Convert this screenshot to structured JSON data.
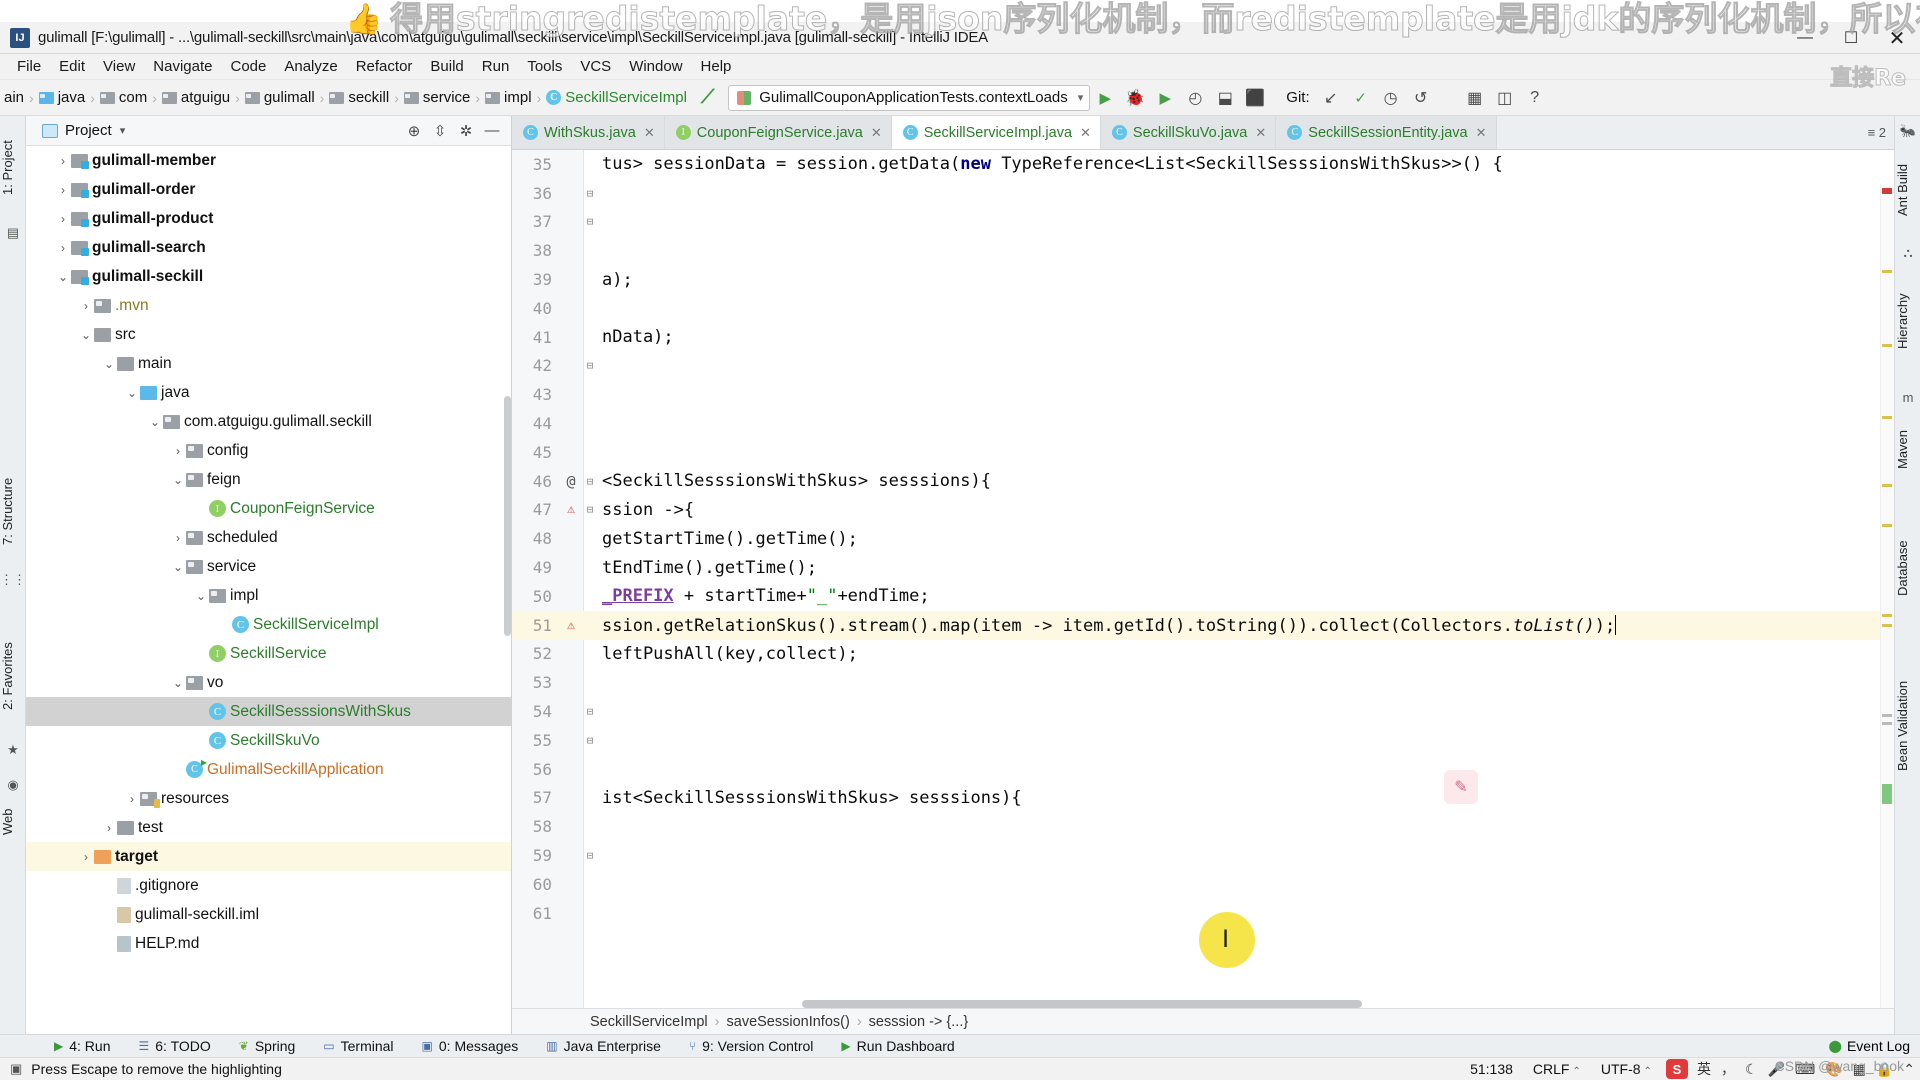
{
  "window": {
    "title": "gulimall [F:\\gulimall] - ...\\gulimall-seckill\\src\\main\\java\\com\\atguigu\\gulimall\\seckill\\service\\impl\\SeckillServiceImpl.java [gulimall-seckill] - IntelliJ IDEA",
    "logo_text": "IJ",
    "minimize": "—",
    "maximize": "☐",
    "close": "✕"
  },
  "watermark": {
    "top_text": "得用stringredistemplate，是用json序列化机制，而redistemplate是用jdk的序列化机制，所以存进redis会发",
    "right_text": "直接Re",
    "credit": "CSDN @wang_book",
    "thumb_icon": "thumbs-up-icon"
  },
  "menu": {
    "items": [
      "File",
      "Edit",
      "View",
      "Navigate",
      "Code",
      "Analyze",
      "Refactor",
      "Build",
      "Run",
      "Tools",
      "VCS",
      "Window",
      "Help"
    ]
  },
  "navbar": {
    "breadcrumbs": [
      {
        "label": "ain",
        "icon": "none"
      },
      {
        "label": "java",
        "icon": "folder-blue"
      },
      {
        "label": "com",
        "icon": "folder"
      },
      {
        "label": "atguigu",
        "icon": "folder"
      },
      {
        "label": "gulimall",
        "icon": "folder"
      },
      {
        "label": "seckill",
        "icon": "folder"
      },
      {
        "label": "service",
        "icon": "folder"
      },
      {
        "label": "impl",
        "icon": "folder"
      },
      {
        "label": "SeckillServiceImpl",
        "icon": "class"
      }
    ],
    "run_config": "GulimallCouponApplicationTests.contextLoads",
    "git_label": "Git:",
    "buttons": [
      "run-button",
      "debug-button",
      "run-with-coverage-button",
      "profile-button",
      "build-button",
      "stop-button"
    ]
  },
  "left_toolwindows": [
    {
      "label": "1: Project"
    },
    {
      "label": "7: Structure"
    },
    {
      "label": "2: Favorites"
    },
    {
      "label": "Web"
    }
  ],
  "right_toolwindows": [
    {
      "label": "Ant Build"
    },
    {
      "label": "Hierarchy"
    },
    {
      "label": "Maven"
    },
    {
      "label": "Database"
    },
    {
      "label": "Bean Validation"
    }
  ],
  "project_panel": {
    "title": "Project",
    "locate_icon": "crosshair-icon",
    "collapse_icon": "collapse-all-icon",
    "settings_icon": "gear-icon",
    "hide_icon": "hide-icon",
    "tree": [
      {
        "label": "gulimall-member",
        "indent": 1,
        "arrow": "›",
        "icon": "module",
        "style": "bold"
      },
      {
        "label": "gulimall-order",
        "indent": 1,
        "arrow": "›",
        "icon": "module",
        "style": "bold"
      },
      {
        "label": "gulimall-product",
        "indent": 1,
        "arrow": "›",
        "icon": "module",
        "style": "bold"
      },
      {
        "label": "gulimall-search",
        "indent": 1,
        "arrow": "›",
        "icon": "module",
        "style": "bold"
      },
      {
        "label": "gulimall-seckill",
        "indent": 1,
        "arrow": "⌄",
        "icon": "module",
        "style": "bold"
      },
      {
        "label": ".mvn",
        "indent": 2,
        "arrow": "›",
        "icon": "folder",
        "style": "yellow"
      },
      {
        "label": "src",
        "indent": 2,
        "arrow": "⌄",
        "icon": "folder-plain",
        "style": "plain"
      },
      {
        "label": "main",
        "indent": 3,
        "arrow": "⌄",
        "icon": "folder-plain",
        "style": "plain"
      },
      {
        "label": "java",
        "indent": 4,
        "arrow": "⌄",
        "icon": "folder-blue",
        "style": "plain"
      },
      {
        "label": "com.atguigu.gulimall.seckill",
        "indent": 5,
        "arrow": "⌄",
        "icon": "folder",
        "style": "plain"
      },
      {
        "label": "config",
        "indent": 6,
        "arrow": "›",
        "icon": "folder",
        "style": "plain"
      },
      {
        "label": "feign",
        "indent": 6,
        "arrow": "⌄",
        "icon": "folder",
        "style": "plain"
      },
      {
        "label": "CouponFeignService",
        "indent": 7,
        "arrow": "",
        "icon": "interface",
        "style": "green"
      },
      {
        "label": "scheduled",
        "indent": 6,
        "arrow": "›",
        "icon": "folder",
        "style": "plain"
      },
      {
        "label": "service",
        "indent": 6,
        "arrow": "⌄",
        "icon": "folder",
        "style": "plain"
      },
      {
        "label": "impl",
        "indent": 7,
        "arrow": "⌄",
        "icon": "folder",
        "style": "plain"
      },
      {
        "label": "SeckillServiceImpl",
        "indent": 8,
        "arrow": "",
        "icon": "class",
        "style": "green"
      },
      {
        "label": "SeckillService",
        "indent": 7,
        "arrow": "",
        "icon": "interface",
        "style": "green"
      },
      {
        "label": "vo",
        "indent": 6,
        "arrow": "⌄",
        "icon": "folder",
        "style": "plain"
      },
      {
        "label": "SeckillSesssionsWithSkus",
        "indent": 7,
        "arrow": "",
        "icon": "class",
        "style": "green",
        "selected": true
      },
      {
        "label": "SeckillSkuVo",
        "indent": 7,
        "arrow": "",
        "icon": "class",
        "style": "green"
      },
      {
        "label": "GulimallSeckillApplication",
        "indent": 6,
        "arrow": "",
        "icon": "spring-class",
        "style": "orange"
      },
      {
        "label": "resources",
        "indent": 4,
        "arrow": "›",
        "icon": "folder-res",
        "style": "plain"
      },
      {
        "label": "test",
        "indent": 3,
        "arrow": "›",
        "icon": "folder-plain",
        "style": "plain"
      },
      {
        "label": "target",
        "indent": 2,
        "arrow": "›",
        "icon": "folder-orange",
        "style": "bold",
        "highlight": true
      },
      {
        "label": ".gitignore",
        "indent": 3,
        "arrow": "",
        "icon": "file",
        "style": "plain"
      },
      {
        "label": "gulimall-seckill.iml",
        "indent": 3,
        "arrow": "",
        "icon": "file-iml",
        "style": "plain"
      },
      {
        "label": "HELP.md",
        "indent": 3,
        "arrow": "",
        "icon": "file-md",
        "style": "plain"
      }
    ]
  },
  "editor": {
    "tabs": [
      {
        "label": "WithSkus.java",
        "icon": "class",
        "active": false,
        "close": "✕"
      },
      {
        "label": "CouponFeignService.java",
        "icon": "interface",
        "active": false,
        "close": "✕"
      },
      {
        "label": "SeckillServiceImpl.java",
        "icon": "class",
        "active": true,
        "close": "✕"
      },
      {
        "label": "SeckillSkuVo.java",
        "icon": "class",
        "active": false,
        "close": "✕"
      },
      {
        "label": "SeckillSessionEntity.java",
        "icon": "class",
        "active": false,
        "close": "✕"
      }
    ],
    "tabs_right_label": "≡ 2",
    "lines": [
      {
        "num": "35",
        "gutter": "",
        "fold": "",
        "text": "tus> sessionData = session.getData(new TypeReference<List<SeckillSesssionsWithSkus>>() {"
      },
      {
        "num": "36",
        "gutter": "",
        "fold": "⊟",
        "text": ""
      },
      {
        "num": "37",
        "gutter": "",
        "fold": "⊟",
        "text": ""
      },
      {
        "num": "38",
        "gutter": "",
        "fold": "",
        "text": ""
      },
      {
        "num": "39",
        "gutter": "",
        "fold": "",
        "text": "a);"
      },
      {
        "num": "40",
        "gutter": "",
        "fold": "",
        "text": ""
      },
      {
        "num": "41",
        "gutter": "",
        "fold": "",
        "text": "nData);"
      },
      {
        "num": "42",
        "gutter": "",
        "fold": "⊟",
        "text": ""
      },
      {
        "num": "43",
        "gutter": "",
        "fold": "",
        "text": ""
      },
      {
        "num": "44",
        "gutter": "",
        "fold": "",
        "text": ""
      },
      {
        "num": "45",
        "gutter": "",
        "fold": "",
        "text": ""
      },
      {
        "num": "46",
        "gutter": "@",
        "fold": "⊟",
        "text": "<SeckillSesssionsWithSkus> sesssions){"
      },
      {
        "num": "47",
        "gutter": "⚠",
        "fold": "⊟",
        "text": "ssion ->{"
      },
      {
        "num": "48",
        "gutter": "",
        "fold": "",
        "text": "getStartTime().getTime();"
      },
      {
        "num": "49",
        "gutter": "",
        "fold": "",
        "text": "tEndTime().getTime();"
      },
      {
        "num": "50",
        "gutter": "",
        "fold": "",
        "text": "_PREFIX + startTime+\"_\"+endTime;"
      },
      {
        "num": "51",
        "gutter": "⚠",
        "fold": "",
        "text": "ssion.getRelationSkus().stream().map(item -> item.getId().toString()).collect(Collectors.toList());",
        "highlight": true
      },
      {
        "num": "52",
        "gutter": "",
        "fold": "",
        "text": "leftPushAll(key,collect);"
      },
      {
        "num": "53",
        "gutter": "",
        "fold": "",
        "text": ""
      },
      {
        "num": "54",
        "gutter": "",
        "fold": "⊟",
        "text": ""
      },
      {
        "num": "55",
        "gutter": "",
        "fold": "⊟",
        "text": ""
      },
      {
        "num": "56",
        "gutter": "",
        "fold": "",
        "text": ""
      },
      {
        "num": "57",
        "gutter": "",
        "fold": "",
        "text": "ist<SeckillSesssionsWithSkus> sesssions){"
      },
      {
        "num": "58",
        "gutter": "",
        "fold": "",
        "text": ""
      },
      {
        "num": "59",
        "gutter": "",
        "fold": "⊟",
        "text": ""
      },
      {
        "num": "60",
        "gutter": "",
        "fold": "",
        "text": ""
      },
      {
        "num": "61",
        "gutter": "",
        "fold": "",
        "text": ""
      }
    ],
    "breadcrumb_bottom": [
      "SeckillServiceImpl",
      "saveSessionInfos()",
      "sesssion -> {...}"
    ],
    "ai_badge_icon": "ai-assistant-icon"
  },
  "bottom_toolwindows": [
    {
      "label": "4: Run",
      "icon": "play-icon"
    },
    {
      "label": "6: TODO",
      "icon": "list-icon"
    },
    {
      "label": "Spring",
      "icon": "leaf-icon"
    },
    {
      "label": "Terminal",
      "icon": "terminal-icon"
    },
    {
      "label": "0: Messages",
      "icon": "message-icon"
    },
    {
      "label": "Java Enterprise",
      "icon": "enterprise-icon"
    },
    {
      "label": "9: Version Control",
      "icon": "branch-icon"
    },
    {
      "label": "Run Dashboard",
      "icon": "dashboard-icon"
    }
  ],
  "event_log": {
    "label": "Event Log",
    "icon": "bell-icon"
  },
  "statusbar": {
    "message": "Press Escape to remove the highlighting",
    "message_icon": "info-icon",
    "position": "51:138",
    "line_separator": "CRLF",
    "encoding": "UTF-8",
    "ime_badge": "S",
    "ime_mode": "英",
    "lock_icon": "lock-icon",
    "gear_icon": "gear-icon",
    "icons": [
      "mic-icon",
      "keyboard-icon",
      "palette-icon",
      "grid-icon",
      "speaker-icon",
      "chevron-up-icon"
    ]
  },
  "colors": {
    "accent_blue": "#31aee3",
    "class_green": "#2a7d2a",
    "spring_orange": "#cc6d22",
    "highlight_yellow": "#fdf8e2",
    "selection_gray": "#d2d2d2",
    "cursor_yellow": "#f5e54b"
  }
}
